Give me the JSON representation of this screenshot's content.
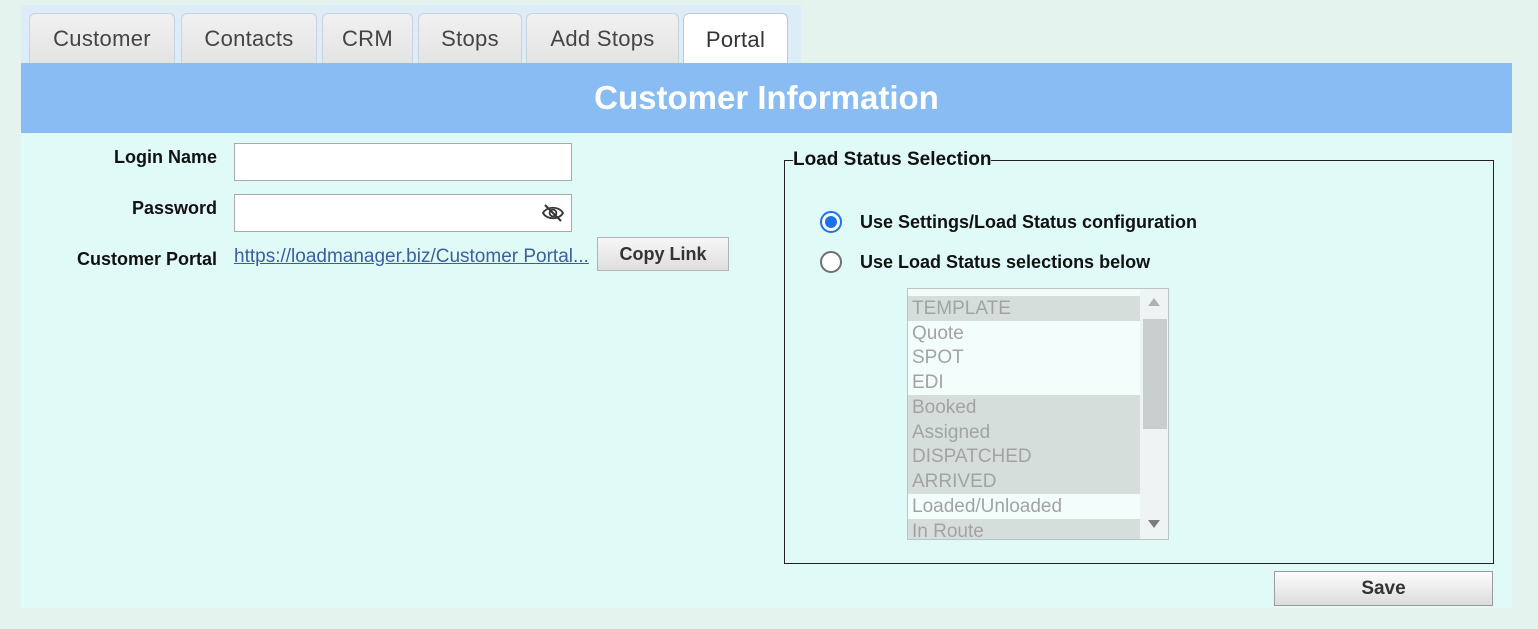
{
  "tabs": [
    {
      "label": "Customer"
    },
    {
      "label": "Contacts"
    },
    {
      "label": "CRM"
    },
    {
      "label": "Stops"
    },
    {
      "label": "Add Stops"
    },
    {
      "label": "Portal"
    }
  ],
  "active_tab": "Portal",
  "banner": {
    "title": "Customer Information"
  },
  "form": {
    "login_name_label": "Login Name",
    "login_name_value": "",
    "password_label": "Password",
    "password_value": "",
    "password_toggle_icon": "eye-slash-icon",
    "customer_portal_label": "Customer Portal",
    "customer_portal_link": "https://loadmanager.biz/Customer Portal...",
    "copy_link_label": "Copy Link"
  },
  "load_status": {
    "legend": "Load Status Selection",
    "options": [
      {
        "label": "Use Settings/Load Status configuration",
        "checked": true
      },
      {
        "label": "Use Load Status selections below",
        "checked": false
      }
    ],
    "list": [
      {
        "label": "TEMPLATE",
        "selected": true
      },
      {
        "label": "Quote",
        "selected": false
      },
      {
        "label": "SPOT",
        "selected": false
      },
      {
        "label": "EDI",
        "selected": false
      },
      {
        "label": "Booked",
        "selected": true
      },
      {
        "label": "Assigned",
        "selected": true
      },
      {
        "label": "DISPATCHED",
        "selected": true
      },
      {
        "label": "ARRIVED",
        "selected": true
      },
      {
        "label": "Loaded/Unloaded",
        "selected": false
      },
      {
        "label": "In Route",
        "selected": true
      }
    ]
  },
  "save_label": "Save",
  "colors": {
    "banner": "#88bcf2",
    "panel": "#e0fbf7",
    "page_background": "#e4f3ee",
    "radio_accent": "#1a73e8",
    "link": "#3a5f9c"
  }
}
